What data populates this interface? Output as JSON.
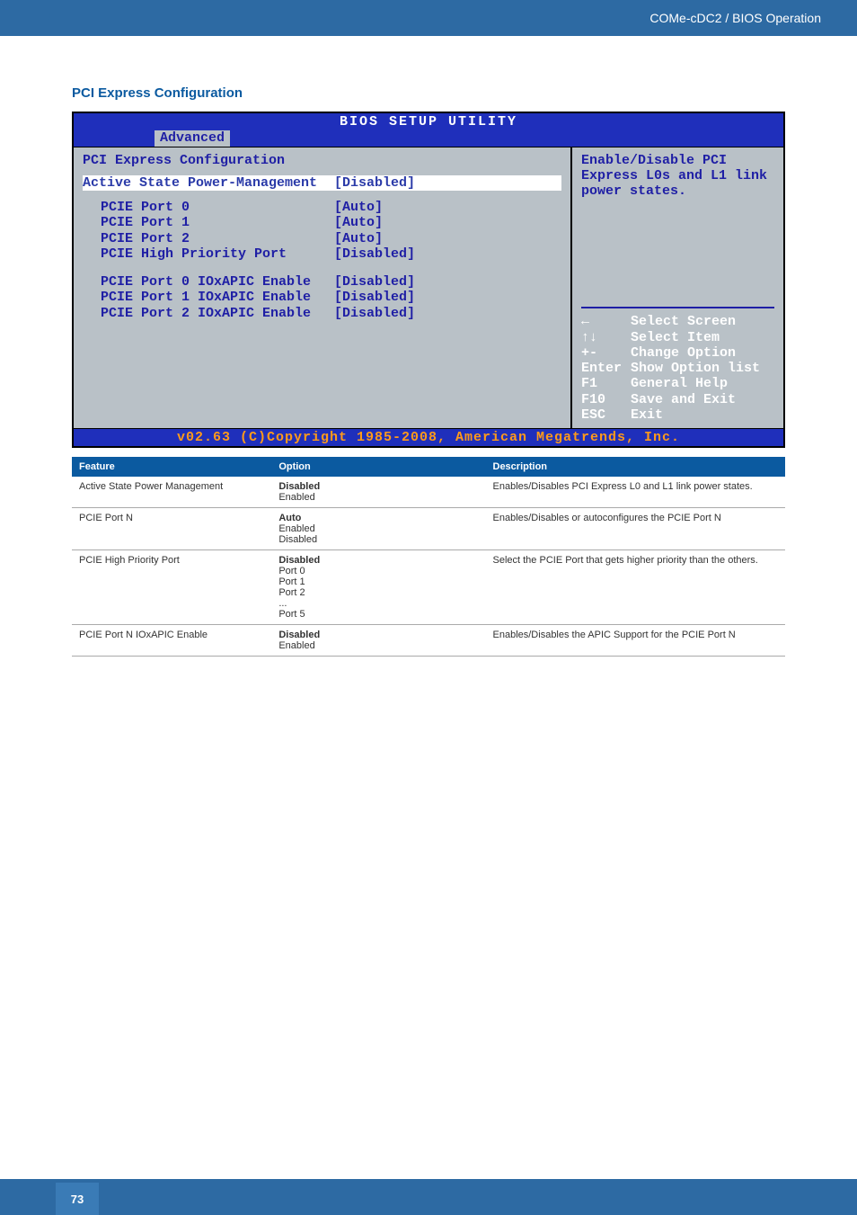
{
  "header": {
    "breadcrumb": "COMe-cDC2 / BIOS Operation"
  },
  "section": {
    "title": "PCI Express Configuration"
  },
  "bios": {
    "title": "BIOS SETUP UTILITY",
    "active_tab": "Advanced",
    "panel_title": "PCI Express Configuration",
    "active_row": {
      "label": "Active State Power-Management",
      "value": "[Disabled]"
    },
    "rows": [
      {
        "label": "PCIE Port 0",
        "value": "[Auto]"
      },
      {
        "label": "PCIE Port 1",
        "value": "[Auto]"
      },
      {
        "label": "PCIE Port 2",
        "value": "[Auto]"
      },
      {
        "label": "PCIE High Priority Port",
        "value": "[Disabled]"
      }
    ],
    "rows2": [
      {
        "label": "PCIE Port 0 IOxAPIC Enable",
        "value": "[Disabled]"
      },
      {
        "label": "PCIE Port 1 IOxAPIC Enable",
        "value": "[Disabled]"
      },
      {
        "label": "PCIE Port 2 IOxAPIC Enable",
        "value": "[Disabled]"
      }
    ],
    "help_text": "Enable/Disable PCI Express L0s and L1 link power states.",
    "keys": [
      {
        "key": "←",
        "action": "Select Screen"
      },
      {
        "key": "↑↓",
        "action": "Select Item"
      },
      {
        "key": "+-",
        "action": "Change Option"
      },
      {
        "key": "Enter",
        "action": "Show Option list"
      },
      {
        "key": "F1",
        "action": "General Help"
      },
      {
        "key": "F10",
        "action": "Save and Exit"
      },
      {
        "key": "ESC",
        "action": "Exit"
      }
    ],
    "footer": "v02.63 (C)Copyright 1985-2008, American Megatrends, Inc."
  },
  "table": {
    "headers": {
      "feature": "Feature",
      "option": "Option",
      "description": "Description"
    },
    "rows": [
      {
        "feature": "Active State Power Management",
        "default": "Disabled",
        "options": [
          "Enabled"
        ],
        "description": "Enables/Disables PCI Express L0 and L1 link power states."
      },
      {
        "feature": "PCIE Port N",
        "default": "Auto",
        "options": [
          "Enabled",
          "Disabled"
        ],
        "description": "Enables/Disables or autoconfigures the PCIE Port N"
      },
      {
        "feature": "PCIE High Priority Port",
        "default": "Disabled",
        "options": [
          "Port 0",
          "Port 1",
          "Port 2",
          "...",
          "Port 5"
        ],
        "description": "Select the PCIE Port that gets higher priority than the others."
      },
      {
        "feature": "PCIE Port N IOxAPIC Enable",
        "default": "Disabled",
        "options": [
          "Enabled"
        ],
        "description": "Enables/Disables the APIC Support for the PCIE Port N"
      }
    ]
  },
  "footer": {
    "page": "73"
  }
}
